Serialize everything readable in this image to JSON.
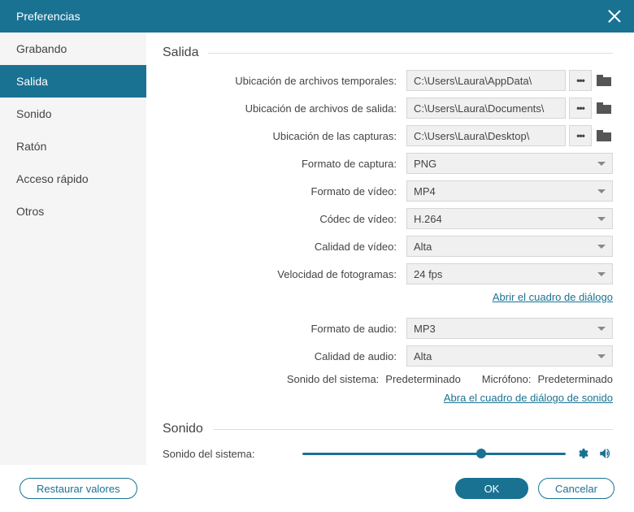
{
  "title": "Preferencias",
  "sidebar": {
    "items": [
      {
        "label": "Grabando"
      },
      {
        "label": "Salida"
      },
      {
        "label": "Sonido"
      },
      {
        "label": "Ratón"
      },
      {
        "label": "Acceso rápido"
      },
      {
        "label": "Otros"
      }
    ],
    "activeIndex": 1
  },
  "sections": {
    "output": {
      "heading": "Salida",
      "tempPathLabel": "Ubicación de archivos temporales:",
      "tempPathValue": "C:\\Users\\Laura\\AppData\\",
      "outputPathLabel": "Ubicación de archivos de salida:",
      "outputPathValue": "C:\\Users\\Laura\\Documents\\",
      "capturePathLabel": "Ubicación de las capturas:",
      "capturePathValue": "C:\\Users\\Laura\\Desktop\\",
      "captureFormatLabel": "Formato de captura:",
      "captureFormatValue": "PNG",
      "videoFormatLabel": "Formato de vídeo:",
      "videoFormatValue": "MP4",
      "videoCodecLabel": "Códec de vídeo:",
      "videoCodecValue": "H.264",
      "videoQualityLabel": "Calidad de vídeo:",
      "videoQualityValue": "Alta",
      "fpsLabel": "Velocidad de fotogramas:",
      "fpsValue": "24 fps",
      "openDialogLink": "Abrir el cuadro de diálogo",
      "audioFormatLabel": "Formato de audio:",
      "audioFormatValue": "MP3",
      "audioQualityLabel": "Calidad de audio:",
      "audioQualityValue": "Alta",
      "systemSoundLabel": "Sonido del sistema:",
      "systemSoundValue": "Predeterminado",
      "micLabel": "Micrófono:",
      "micValue": "Predeterminado",
      "openSoundDialogLink": "Abra el cuadro de diálogo de sonido"
    },
    "sound": {
      "heading": "Sonido",
      "systemSoundLabel": "Sonido del sistema:"
    }
  },
  "footer": {
    "restore": "Restaurar valores",
    "ok": "OK",
    "cancel": "Cancelar"
  }
}
